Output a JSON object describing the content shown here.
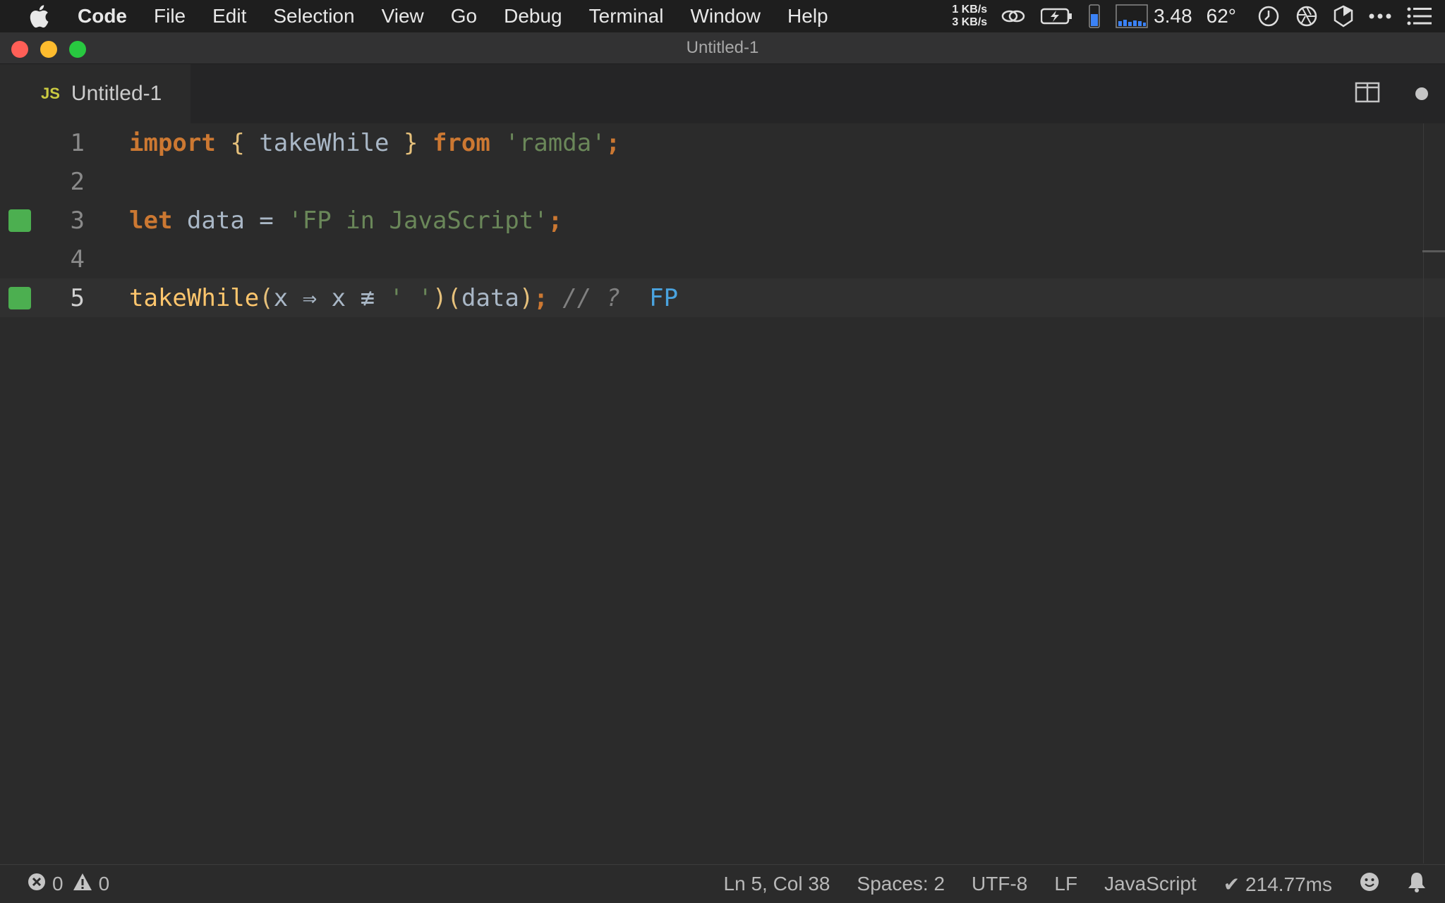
{
  "menubar": {
    "items": [
      "Code",
      "File",
      "Edit",
      "Selection",
      "View",
      "Go",
      "Debug",
      "Terminal",
      "Window",
      "Help"
    ],
    "net_up": "1 KB/s",
    "net_down": "3 KB/s",
    "load": "3.48",
    "temperature": "62°"
  },
  "window": {
    "title": "Untitled-1"
  },
  "tab": {
    "icon": "JS",
    "label": "Untitled-1"
  },
  "editor": {
    "lines": [
      {
        "num": "1",
        "tokens": [
          "import",
          "{",
          "takeWhile",
          "}",
          "from",
          "'ramda'",
          ";"
        ]
      },
      {
        "num": "2"
      },
      {
        "num": "3",
        "tokens": [
          "let",
          "data",
          "=",
          "'FP in JavaScript'",
          ";"
        ]
      },
      {
        "num": "4"
      },
      {
        "num": "5",
        "tokens": [
          "takeWhile",
          "(",
          "x",
          "⇒",
          "x",
          "≢",
          "' '",
          ")",
          "(",
          "data",
          ")",
          ";",
          "// ?",
          "FP"
        ]
      }
    ]
  },
  "statusbar": {
    "errors": "0",
    "warnings": "0",
    "position": "Ln 5, Col 38",
    "spaces": "Spaces: 2",
    "encoding": "UTF-8",
    "eol": "LF",
    "language": "JavaScript",
    "timing": "✔ 214.77ms"
  },
  "colors": {
    "background": "#2b2b2b",
    "keyword": "#cc7832",
    "string": "#6a8759",
    "function": "#ffc66d",
    "result": "#4aa3df",
    "coverage": "#4caf50"
  }
}
